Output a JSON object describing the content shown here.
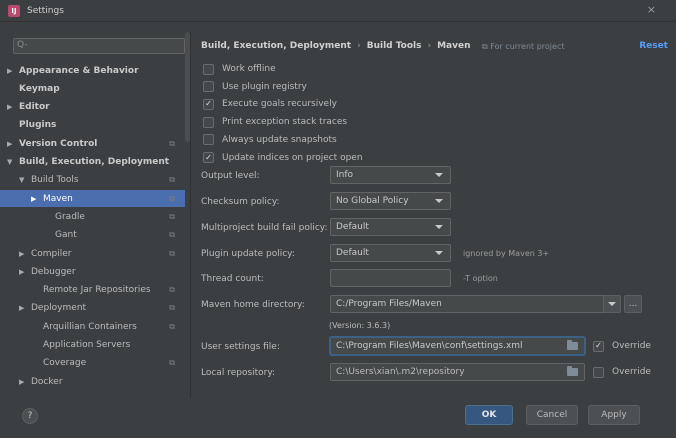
{
  "window": {
    "title": "Settings",
    "close": "×"
  },
  "search": {
    "placeholder": "Q-",
    "icon": "search-icon"
  },
  "tree": [
    {
      "label": "Appearance & Behavior",
      "bold": true,
      "arrow": "▶"
    },
    {
      "label": "Keymap",
      "bold": true,
      "arrow": ""
    },
    {
      "label": "Editor",
      "bold": true,
      "arrow": "▶"
    },
    {
      "label": "Plugins",
      "bold": true,
      "arrow": ""
    },
    {
      "label": "Version Control",
      "bold": true,
      "arrow": "▶",
      "proj": true
    },
    {
      "label": "Build, Execution, Deployment",
      "bold": true,
      "arrow": "▼"
    },
    {
      "label": "Build Tools",
      "arrow": "▼",
      "proj": true
    },
    {
      "label": "Maven",
      "arrow": "▶",
      "proj": true,
      "selected": true
    },
    {
      "label": "Gradle",
      "arrow": "",
      "proj": true
    },
    {
      "label": "Gant",
      "arrow": "",
      "proj": true
    },
    {
      "label": "Compiler",
      "arrow": "▶",
      "proj": true
    },
    {
      "label": "Debugger",
      "arrow": "▶"
    },
    {
      "label": "Remote Jar Repositories",
      "arrow": "",
      "proj": true
    },
    {
      "label": "Deployment",
      "arrow": "▶",
      "proj": true
    },
    {
      "label": "Arquillian Containers",
      "arrow": "",
      "proj": true
    },
    {
      "label": "Application Servers",
      "arrow": ""
    },
    {
      "label": "Coverage",
      "arrow": "",
      "proj": true
    },
    {
      "label": "Docker",
      "arrow": "▶"
    }
  ],
  "breadcrumb": {
    "part1": "Build, Execution, Deployment",
    "sep": "›",
    "part2": "Build Tools",
    "part3": "Maven",
    "for_project": "For current project",
    "reset": "Reset"
  },
  "checkboxes": [
    {
      "label": "Work offline",
      "checked": false
    },
    {
      "label": "Use plugin registry",
      "checked": false
    },
    {
      "label": "Execute goals recursively",
      "checked": true
    },
    {
      "label": "Print exception stack traces",
      "checked": false
    },
    {
      "label": "Always update snapshots",
      "checked": false
    },
    {
      "label": "Update indices on project open",
      "checked": true
    }
  ],
  "check_mark": "✓",
  "form": {
    "output_level_label": "Output level:",
    "output_level_value": "Info",
    "checksum_label": "Checksum policy:",
    "checksum_value": "No Global Policy",
    "multiproject_label": "Multiproject build fail policy:",
    "multiproject_value": "Default",
    "plugin_update_label": "Plugin update policy:",
    "plugin_update_value": "Default",
    "plugin_update_hint": "ignored by Maven 3+",
    "thread_count_label": "Thread count:",
    "thread_count_value": "",
    "thread_count_hint": "-T option",
    "maven_home_label": "Maven home directory:",
    "maven_home_value": "C:/Program Files/Maven",
    "maven_version": "(Version: 3.6.3)",
    "browse": "...",
    "user_settings_label": "User settings file:",
    "user_settings_value": "C:\\Program Files\\Maven\\conf\\settings.xml",
    "user_settings_override": "Override",
    "local_repo_label": "Local repository:",
    "local_repo_value": "C:\\Users\\xian\\.m2\\repository",
    "local_repo_override": "Override"
  },
  "footer": {
    "help": "?",
    "ok": "OK",
    "cancel": "Cancel",
    "apply": "Apply"
  }
}
